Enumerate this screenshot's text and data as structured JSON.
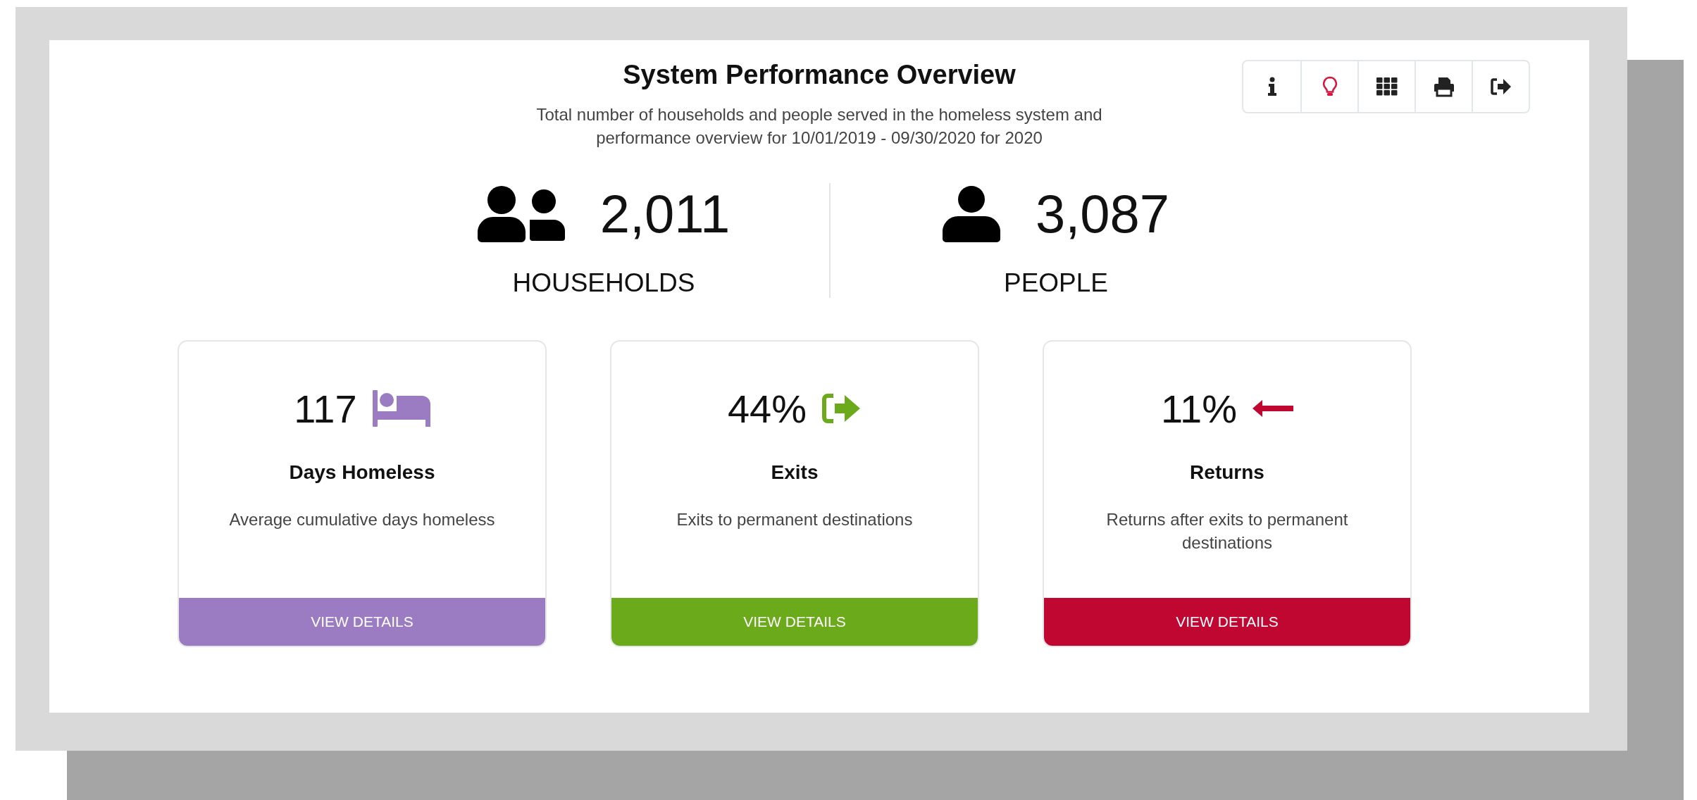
{
  "header": {
    "title": "System Performance Overview",
    "subtitle_lines": [
      "Total number of households and people served in the homeless system and",
      "performance overview for 10/01/2019 - 09/30/2020 for 2020"
    ]
  },
  "toolbar": [
    {
      "kind": "info"
    },
    {
      "kind": "bulb"
    },
    {
      "kind": "grid"
    },
    {
      "kind": "print"
    },
    {
      "kind": "export"
    }
  ],
  "totals": [
    {
      "kind": "group",
      "value": "2,011",
      "label": "HOUSEHOLDS"
    },
    {
      "kind": "person",
      "value": "3,087",
      "label": "PEOPLE"
    }
  ],
  "cards": [
    {
      "kind": "bed",
      "color": "#9b7cc2",
      "value": "117",
      "title": "Days Homeless",
      "description": "Average cumulative days homeless",
      "button": "VIEW DETAILS"
    },
    {
      "kind": "exit",
      "color": "#6aaa1b",
      "value": "44%",
      "title": "Exits",
      "description": "Exits to permanent destinations",
      "button": "VIEW DETAILS"
    },
    {
      "kind": "return",
      "color": "#c00732",
      "value": "11%",
      "title": "Returns",
      "description": "Returns after exits to permanent destinations",
      "button": "VIEW DETAILS"
    }
  ]
}
